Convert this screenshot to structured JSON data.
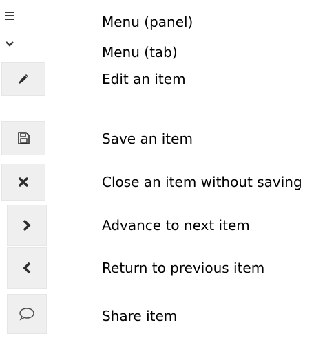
{
  "legend": {
    "items": [
      {
        "icon": "hamburger-icon",
        "label": "Menu (panel)"
      },
      {
        "icon": "chevron-down-icon",
        "label": "Menu (tab)"
      },
      {
        "icon": "pencil-icon",
        "label": "Edit an item"
      },
      {
        "icon": "save-disk-icon",
        "label": "Save an item"
      },
      {
        "icon": "close-x-icon",
        "label": "Close an item without saving"
      },
      {
        "icon": "chevron-right-icon",
        "label": "Advance to next item"
      },
      {
        "icon": "chevron-left-icon",
        "label": "Return to previous item"
      },
      {
        "icon": "speech-bubble-icon",
        "label": "Share item"
      }
    ]
  },
  "colors": {
    "icon_dark": "#2d2d2d",
    "icon_box_bg": "#efefef",
    "text": "#000000"
  }
}
